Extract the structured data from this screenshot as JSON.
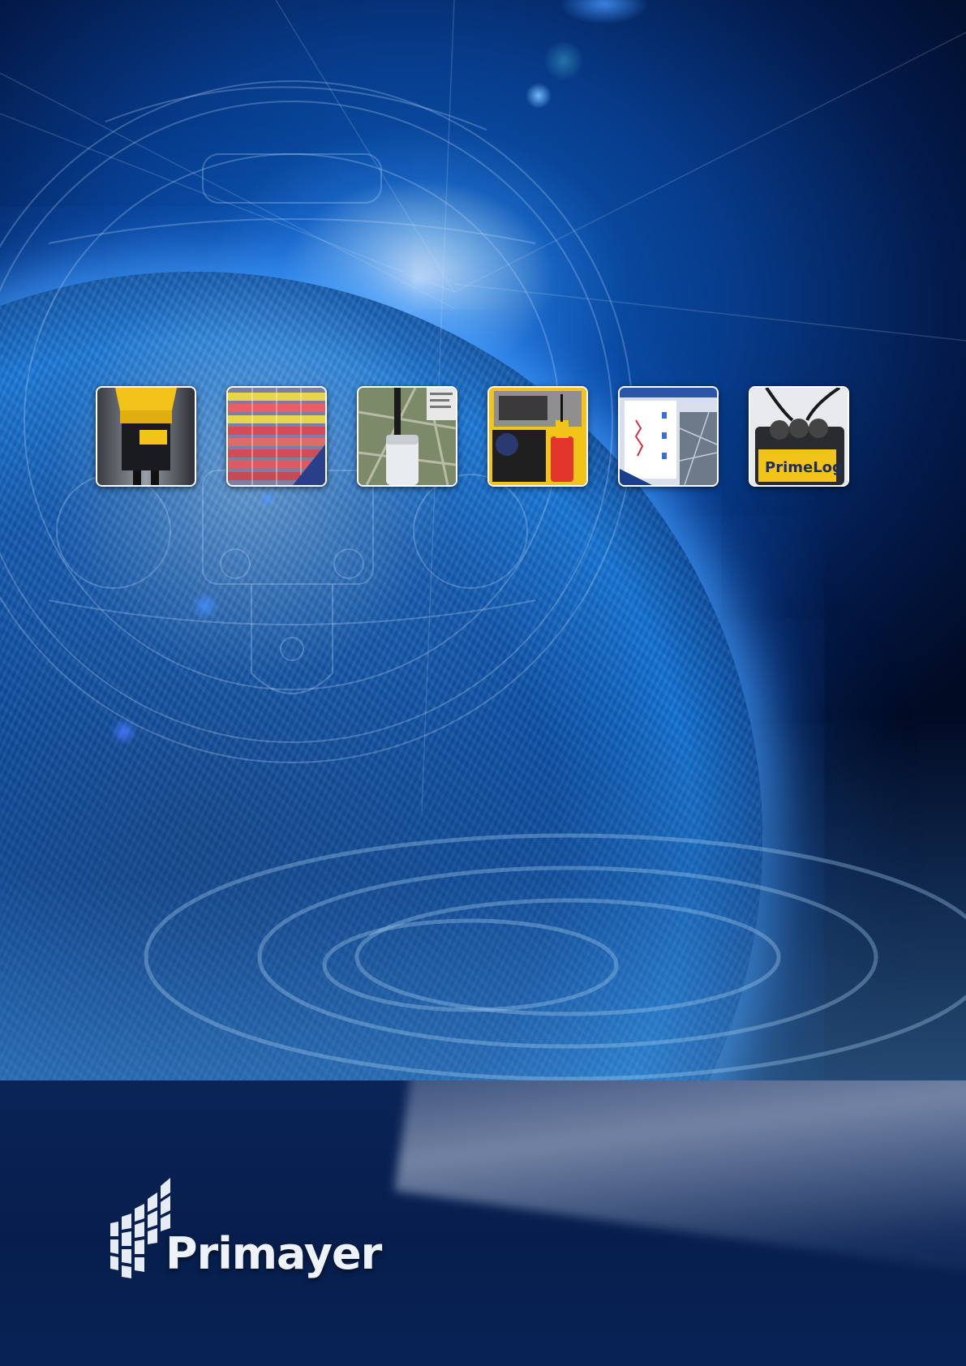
{
  "brand": {
    "name": "Primayer"
  },
  "thumbnails": [
    {
      "id": "logger",
      "icon": "yellow-logger-device-icon"
    },
    {
      "id": "chart",
      "icon": "data-chart-screen-icon"
    },
    {
      "id": "map",
      "icon": "map-antenna-icon"
    },
    {
      "id": "case",
      "icon": "yellow-case-equipment-icon"
    },
    {
      "id": "software",
      "icon": "software-screenshot-icon"
    },
    {
      "id": "primelog",
      "icon": "primelog-device-icon",
      "label": "PrimeLog"
    }
  ],
  "colors": {
    "space": "#02112e",
    "earth_glow": "#1473d6",
    "band": "#0a2457",
    "logo_text": "#eef3fb",
    "device_yellow": "#f2c318"
  }
}
